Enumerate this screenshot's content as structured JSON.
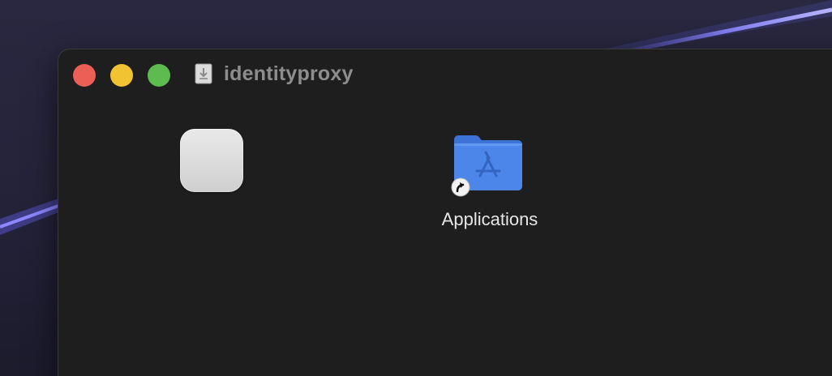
{
  "window": {
    "title": "identityproxy",
    "title_icon": "disk-image-icon",
    "buttons": {
      "close": "close-button",
      "minimize": "minimize-button",
      "zoom": "zoom-button"
    }
  },
  "items": [
    {
      "kind": "app",
      "label": "",
      "icon": "app-icon"
    },
    {
      "kind": "alias-folder",
      "label": "Applications",
      "icon": "applications-folder-icon",
      "badge": "alias-arrow-icon"
    }
  ],
  "colors": {
    "close": "#ec5f56",
    "minimize": "#f1c232",
    "zoom": "#5dbb4f",
    "window_bg": "#1e1e1e",
    "folder": "#4b86e8"
  }
}
